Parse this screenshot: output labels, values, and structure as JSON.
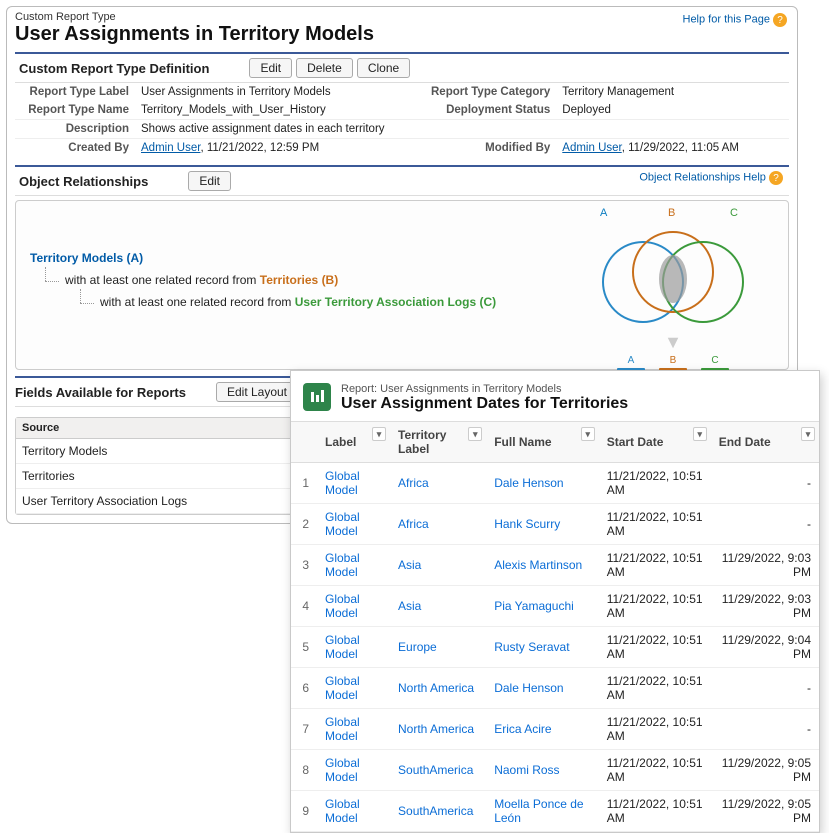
{
  "help": {
    "page": "Help for this Page",
    "obj_rel": "Object Relationships Help"
  },
  "header": {
    "eyebrow": "Custom Report Type",
    "title": "User Assignments in Territory Models"
  },
  "definition": {
    "section_title": "Custom Report Type Definition",
    "buttons": {
      "edit": "Edit",
      "delete": "Delete",
      "clone": "Clone"
    },
    "labels": {
      "report_type_label": "Report Type Label",
      "report_type_name": "Report Type Name",
      "description": "Description",
      "created_by": "Created By",
      "report_type_category": "Report Type Category",
      "deployment_status": "Deployment Status",
      "modified_by": "Modified By"
    },
    "values": {
      "report_type_label": "User Assignments in Territory Models",
      "report_type_name": "Territory_Models_with_User_History",
      "description": "Shows active assignment dates in each territory",
      "created_by_user": "Admin User",
      "created_by_time": ", 11/21/2022, 12:59 PM",
      "report_type_category": "Territory Management",
      "deployment_status": "Deployed",
      "modified_by_user": "Admin User",
      "modified_by_time": ", 11/29/2022, 11:05 AM"
    }
  },
  "relationships": {
    "section_title": "Object Relationships",
    "edit": "Edit",
    "root": "Territory Models (A)",
    "line1_prefix": "with at least one related record from ",
    "line1_obj": "Territories (B)",
    "line2_prefix": "with at least one related record from ",
    "line2_obj": "User Territory Association Logs (C)"
  },
  "fields": {
    "section_title": "Fields Available for Reports",
    "edit_layout": "Edit Layout",
    "source_header": "Source",
    "rows": [
      "Territory Models",
      "Territories",
      "User Territory Association Logs"
    ]
  },
  "report": {
    "eyebrow": "Report: User Assignments in Territory Models",
    "title": "User Assignment Dates for Territories",
    "columns": {
      "label": "Label",
      "territory_label": "Territory Label",
      "full_name": "Full Name",
      "start_date": "Start Date",
      "end_date": "End Date"
    },
    "rows": [
      {
        "n": "1",
        "label": "Global Model",
        "territory": "Africa",
        "name": "Dale Henson",
        "start": "11/21/2022, 10:51 AM",
        "end": "-"
      },
      {
        "n": "2",
        "label": "Global Model",
        "territory": "Africa",
        "name": "Hank Scurry",
        "start": "11/21/2022, 10:51 AM",
        "end": "-"
      },
      {
        "n": "3",
        "label": "Global Model",
        "territory": "Asia",
        "name": "Alexis Martinson",
        "start": "11/21/2022, 10:51 AM",
        "end": "11/29/2022, 9:03 PM"
      },
      {
        "n": "4",
        "label": "Global Model",
        "territory": "Asia",
        "name": "Pia Yamaguchi",
        "start": "11/21/2022, 10:51 AM",
        "end": "11/29/2022, 9:03 PM"
      },
      {
        "n": "5",
        "label": "Global Model",
        "territory": "Europe",
        "name": "Rusty Seravat",
        "start": "11/21/2022, 10:51 AM",
        "end": "11/29/2022, 9:04 PM"
      },
      {
        "n": "6",
        "label": "Global Model",
        "territory": "North America",
        "name": "Dale Henson",
        "start": "11/21/2022, 10:51 AM",
        "end": "-"
      },
      {
        "n": "7",
        "label": "Global Model",
        "territory": "North America",
        "name": "Erica Acire",
        "start": "11/21/2022, 10:51 AM",
        "end": "-"
      },
      {
        "n": "8",
        "label": "Global Model",
        "territory": "SouthAmerica",
        "name": "Naomi Ross",
        "start": "11/21/2022, 10:51 AM",
        "end": "11/29/2022, 9:05 PM"
      },
      {
        "n": "9",
        "label": "Global Model",
        "territory": "SouthAmerica",
        "name": "Moella Ponce de León",
        "start": "11/21/2022, 10:51 AM",
        "end": "11/29/2022, 9:05 PM"
      }
    ]
  },
  "venn": {
    "A": "A",
    "B": "B",
    "C": "C"
  }
}
